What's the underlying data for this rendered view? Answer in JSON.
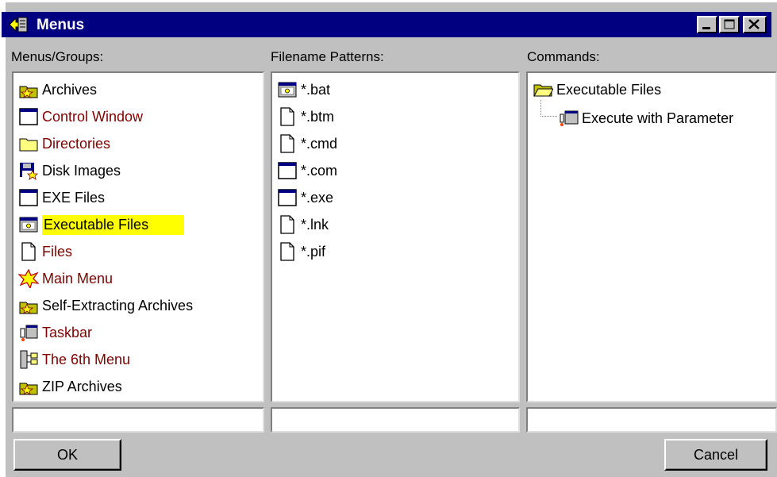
{
  "window": {
    "title": "Menus"
  },
  "columns": {
    "groups_label": "Menus/Groups:",
    "patterns_label": "Filename Patterns:",
    "commands_label": "Commands:"
  },
  "groups": [
    {
      "label": "Archives",
      "icon": "folder-star-icon",
      "red": false
    },
    {
      "label": "Control Window",
      "icon": "window-icon",
      "red": true
    },
    {
      "label": "Directories",
      "icon": "folder-icon",
      "red": true
    },
    {
      "label": "Disk Images",
      "icon": "floppy-star-icon",
      "red": false
    },
    {
      "label": "EXE Files",
      "icon": "window-icon",
      "red": false
    },
    {
      "label": "Executable Files",
      "icon": "executable-window-icon",
      "red": false,
      "selected": true
    },
    {
      "label": "Files",
      "icon": "document-icon",
      "red": true
    },
    {
      "label": "Main Menu",
      "icon": "starburst-icon",
      "red": true
    },
    {
      "label": "Self-Extracting Archives",
      "icon": "folder-star-icon",
      "red": false
    },
    {
      "label": "Taskbar",
      "icon": "taskbar-icon",
      "red": true
    },
    {
      "label": "The 6th Menu",
      "icon": "tree-menu-icon",
      "red": true
    },
    {
      "label": "ZIP Archives",
      "icon": "folder-star-icon",
      "red": false
    }
  ],
  "patterns": [
    {
      "label": "*.bat",
      "icon": "executable-window-icon"
    },
    {
      "label": "*.btm",
      "icon": "document-icon"
    },
    {
      "label": "*.cmd",
      "icon": "document-icon"
    },
    {
      "label": "*.com",
      "icon": "window-icon"
    },
    {
      "label": "*.exe",
      "icon": "window-icon"
    },
    {
      "label": "*.lnk",
      "icon": "document-icon"
    },
    {
      "label": "*.pif",
      "icon": "document-icon"
    }
  ],
  "commands": {
    "root": {
      "label": "Executable Files",
      "icon": "open-folder-icon"
    },
    "child": {
      "label": "Execute with Parameter",
      "icon": "taskbar-icon"
    }
  },
  "fields": {
    "groups_value": "",
    "patterns_value": "",
    "commands_value": ""
  },
  "buttons": {
    "ok": "OK",
    "cancel": "Cancel"
  },
  "colors": {
    "titlebar": "#000080",
    "selection": "#ffff00",
    "red_text": "#800000",
    "face": "#c0c0c0"
  }
}
